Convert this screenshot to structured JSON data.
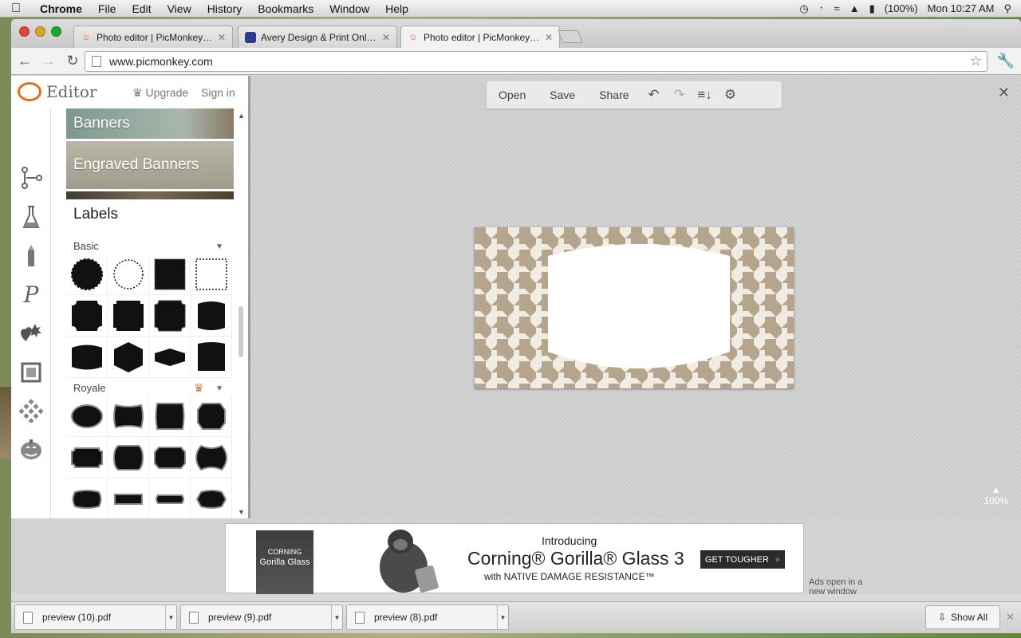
{
  "menubar": {
    "app": "Chrome",
    "items": [
      "File",
      "Edit",
      "View",
      "History",
      "Bookmarks",
      "Window",
      "Help"
    ],
    "battery": "(100%)",
    "clock": "Mon 10:27 AM"
  },
  "tabs": [
    {
      "title": "Photo editor | PicMonkey: Fr"
    },
    {
      "title": "Avery Design & Print Online"
    },
    {
      "title": "Photo editor | PicMonkey: Fr"
    }
  ],
  "url": "www.picmonkey.com",
  "editor": {
    "logo": "Editor",
    "upgrade": "Upgrade",
    "signin": "Sign in"
  },
  "panel": {
    "banner1": "Banners",
    "banner2": "Engraved Banners",
    "heading": "Labels",
    "cat_basic": "Basic",
    "cat_royale": "Royale"
  },
  "topbar": {
    "open": "Open",
    "save": "Save",
    "share": "Share"
  },
  "zoom": "100%",
  "ad": {
    "box_line1": "CORNING",
    "box_line2": "Gorilla Glass",
    "intro": "Introducing",
    "headline": "Corning® Gorilla® Glass 3",
    "sub": "with NATIVE DAMAGE RESISTANCE™",
    "cta": "GET TOUGHER",
    "note": "Ads open in a new window"
  },
  "downloads": [
    {
      "name": "preview (10).pdf"
    },
    {
      "name": "preview (9).pdf"
    },
    {
      "name": "preview (8).pdf"
    }
  ],
  "show_all": "Show All",
  "colors": {
    "accent": "#e36f1e",
    "houndstooth": "#b5a58c"
  },
  "icons": [
    "apple-icon",
    "time-machine-icon",
    "bluetooth-icon",
    "wifi-icon",
    "volume-icon",
    "battery-icon",
    "spotlight-icon",
    "back-icon",
    "forward-icon",
    "reload-icon",
    "star-icon",
    "wrench-icon",
    "basic-edits-icon",
    "effects-icon",
    "touch-up-icon",
    "text-icon",
    "overlays-icon",
    "frames-icon",
    "textures-icon",
    "themes-icon",
    "undo-icon",
    "redo-icon",
    "layers-icon",
    "settings-icon",
    "close-icon"
  ]
}
